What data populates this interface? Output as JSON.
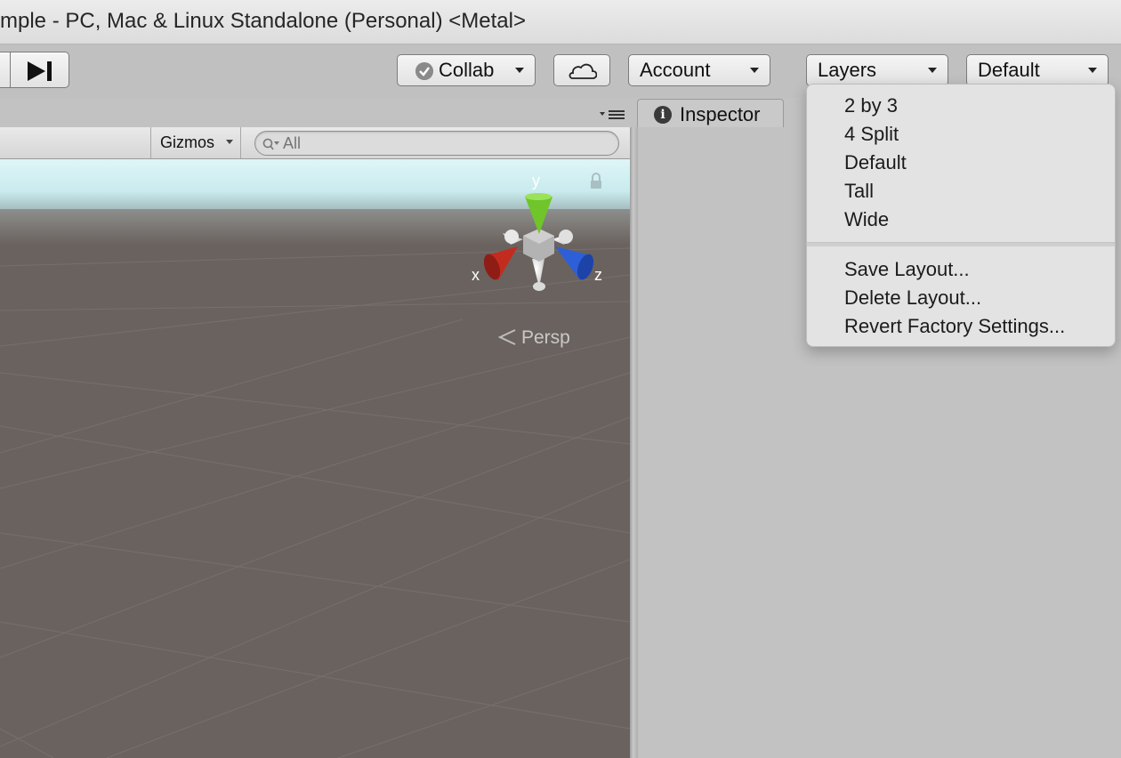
{
  "window": {
    "title": "mple - PC, Mac & Linux Standalone (Personal) <Metal>"
  },
  "toolbar": {
    "collab_label": "Collab",
    "account_label": "Account",
    "layers_label": "Layers",
    "layout_label": "Default",
    "icons": [
      "step-icon",
      "check-icon",
      "cloud-icon",
      "chevron-down-icon"
    ]
  },
  "tabs": {
    "inspector_label": "Inspector",
    "inspector_icon": "info-icon"
  },
  "scene": {
    "gizmos_label": "Gizmos",
    "search_placeholder": "All",
    "axis_x": "x",
    "axis_y": "y",
    "axis_z": "z",
    "projection_label": "Persp",
    "colors": {
      "x_axis": "#c42b1f",
      "y_axis": "#6fc52a",
      "z_axis": "#2d5fd8",
      "ground": "#6a625e",
      "sky": "#d7f1f4"
    }
  },
  "layout_menu": {
    "items": [
      "2 by 3",
      "4 Split",
      "Default",
      "Tall",
      "Wide"
    ],
    "actions": [
      "Save Layout...",
      "Delete Layout...",
      "Revert Factory Settings..."
    ]
  }
}
